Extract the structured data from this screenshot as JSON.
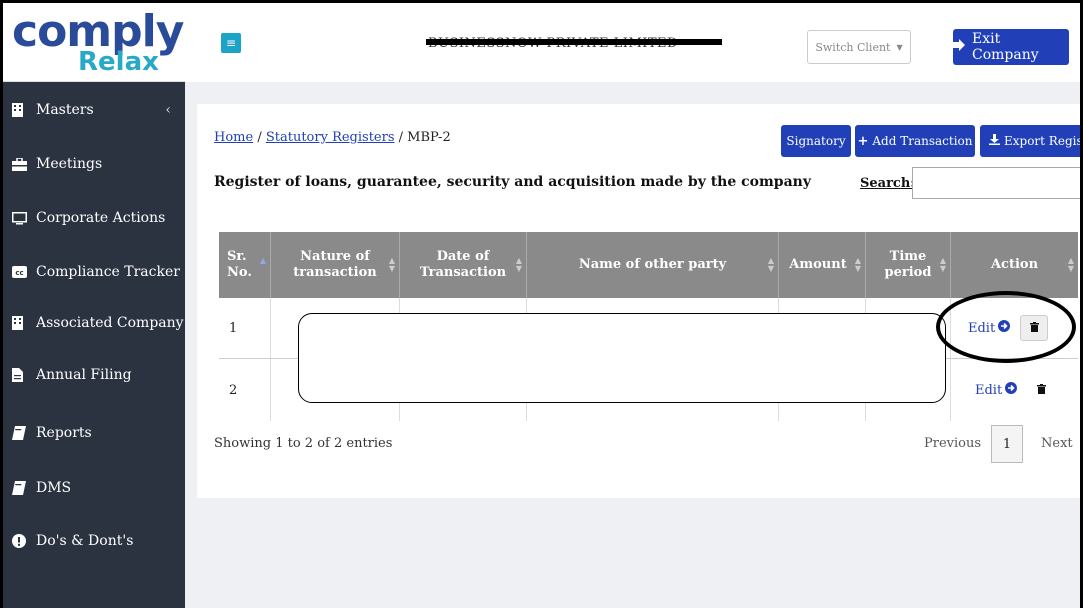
{
  "brand": {
    "logo_main": "comply",
    "logo_sub": "Relax"
  },
  "sidebar": {
    "items": [
      {
        "label": "Masters",
        "icon": "building-icon"
      },
      {
        "label": "Meetings",
        "icon": "briefcase-icon"
      },
      {
        "label": "Corporate Actions",
        "icon": "monitor-icon"
      },
      {
        "label": "Compliance Tracker",
        "icon": "cc-icon"
      },
      {
        "label": "Associated Company",
        "icon": "building-icon"
      },
      {
        "label": "Annual Filing",
        "icon": "file-icon"
      },
      {
        "label": "Reports",
        "icon": "book-icon"
      },
      {
        "label": "DMS",
        "icon": "book-icon"
      },
      {
        "label": "Do's & Dont's",
        "icon": "exclamation-icon"
      }
    ]
  },
  "header": {
    "menu_icon": "≡",
    "company_name": "BUSINESSNOW PRIVATE LIMITED",
    "switch_client": "Switch Client",
    "exit_company": "Exit Company"
  },
  "breadcrumb": {
    "home": "Home",
    "separator": " / ",
    "registers": "Statutory Registers",
    "current": "MBP-2"
  },
  "actions": {
    "signatory": "Signatory",
    "add_transaction": "Add Transaction",
    "export_register": "Export Register"
  },
  "register_title": "Register of loans, guarantee, security and acquisition made by the company",
  "search": {
    "label": "Search:",
    "value": ""
  },
  "table": {
    "headers": [
      "Sr. No.",
      "Nature of transaction",
      "Date of Transaction",
      "Name of other party",
      "Amount",
      "Time period",
      "Action"
    ],
    "rows": [
      {
        "sr": "1",
        "edit": "Edit"
      },
      {
        "sr": "2",
        "edit": "Edit"
      }
    ]
  },
  "footer": {
    "showing": "Showing 1 to 2 of 2 entries",
    "previous": "Previous",
    "page": "1",
    "next": "Next"
  },
  "colors": {
    "sidebar": "#2b3341",
    "primary": "#2140b8",
    "accent": "#1ca3c8",
    "header_row": "#8a8a8a"
  }
}
